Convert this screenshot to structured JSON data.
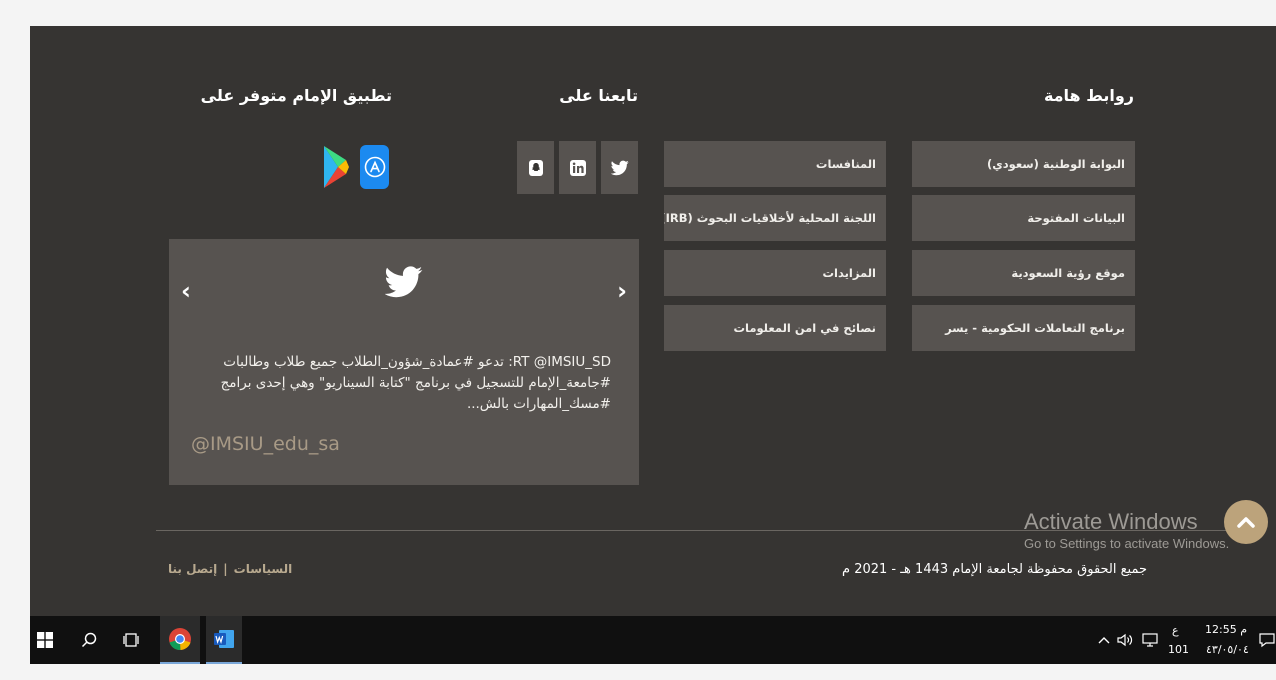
{
  "footer": {
    "links_title": "روابط هامة",
    "follow_title": "تابعنا على",
    "app_title": "تطبيق الإمام متوفر على",
    "links_right": [
      "البوابة الوطنية (سعودي)",
      "البيانات المفتوحة",
      "موقع رؤية السعودية",
      "برنامج التعاملات الحكومية - يسر"
    ],
    "links_left": [
      "المنافسات",
      "اللجنة المحلية لأخلاقيات البحوث (IRB)",
      "المزايدات",
      "نصائح في امن المعلومات"
    ],
    "social_icons": [
      "twitter-icon",
      "linkedin-icon",
      "snapchat-icon"
    ],
    "app_icons": [
      "app-store-icon",
      "google-play-icon"
    ],
    "tweet": {
      "text": "RT @IMSIU_SD: تدعو #عمادة_شؤون_الطلاب جميع طلاب وطالبات #جامعة_الإمام للتسجيل في برنامج \"كتابة السيناريو\" وهي إحدى برامج #مسك_المهارات بالش...",
      "handle": "@IMSIU_edu_sa"
    },
    "copyright": "جميع الحقوق محفوظة لجامعة الإمام 1443 هـ - 2021 م",
    "policies": "السياسات",
    "contact": "إتصل بنا",
    "separator": "|"
  },
  "watermark": {
    "line1": "Activate Windows",
    "line2": "Go to Settings to activate Windows."
  },
  "taskbar": {
    "time": "12:55 م",
    "date": "٤٣/٠٥/٠٤",
    "lang_top": "ع",
    "lang_bottom": "101",
    "apps": [
      "windows-start-icon",
      "search-icon",
      "task-view-icon",
      "chrome-icon",
      "word-icon"
    ]
  },
  "colors": {
    "footer_bg": "#363432",
    "tile_bg": "#575350",
    "accent_gold": "#bca37b",
    "handle_color": "#a89a86",
    "taskbar_bg": "#101010"
  }
}
